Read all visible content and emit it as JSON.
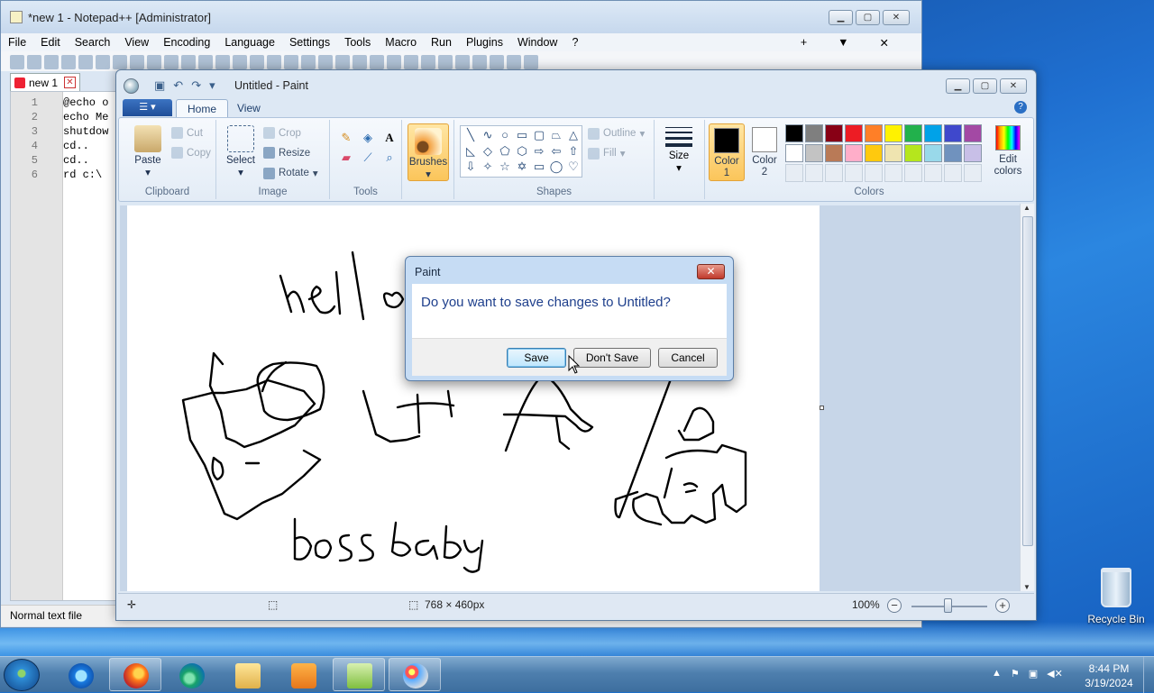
{
  "desktop": {
    "recycle_bin_label": "Recycle Bin"
  },
  "notepad": {
    "title": "*new 1 - Notepad++ [Administrator]",
    "menu": [
      "File",
      "Edit",
      "Search",
      "View",
      "Encoding",
      "Language",
      "Settings",
      "Tools",
      "Macro",
      "Run",
      "Plugins",
      "Window",
      "?"
    ],
    "menu_right": [
      "+",
      "▼",
      "✕"
    ],
    "tab_label": "new 1",
    "lines": [
      {
        "n": "1",
        "text": "@echo o"
      },
      {
        "n": "2",
        "text": "echo Me"
      },
      {
        "n": "3",
        "text": "shutdow"
      },
      {
        "n": "4",
        "text": "cd.."
      },
      {
        "n": "5",
        "text": "cd.."
      },
      {
        "n": "6",
        "text": "rd c:\\ "
      }
    ],
    "status": "Normal text file"
  },
  "paint": {
    "title": "Untitled - Paint",
    "tabs": {
      "home": "Home",
      "view": "View"
    },
    "clipboard": {
      "paste": "Paste",
      "cut": "Cut",
      "copy": "Copy",
      "label": "Clipboard"
    },
    "image": {
      "select": "Select",
      "crop": "Crop",
      "resize": "Resize",
      "rotate": "Rotate",
      "label": "Image"
    },
    "tools": {
      "label": "Tools"
    },
    "brushes": "Brushes",
    "shapes": {
      "outline": "Outline",
      "fill": "Fill",
      "label": "Shapes"
    },
    "size": "Size",
    "colors": {
      "color1_line1": "Color",
      "color1_line2": "1",
      "color2_line1": "Color",
      "color2_line2": "2",
      "edit_line1": "Edit",
      "edit_line2": "colors",
      "label": "Colors",
      "color1_value": "#000000",
      "color2_value": "#ffffff",
      "palette": [
        "#000000",
        "#7f7f7f",
        "#880015",
        "#ed1c24",
        "#ff7f27",
        "#fff200",
        "#22b14c",
        "#00a2e8",
        "#3f48cc",
        "#a349a4",
        "#ffffff",
        "#c3c3c3",
        "#b97a57",
        "#ffaec9",
        "#ffc90e",
        "#efe4b0",
        "#b5e61d",
        "#99d9ea",
        "#7092be",
        "#c8bfe7"
      ]
    },
    "status": {
      "dimensions": "768 × 460px",
      "zoom": "100%"
    },
    "canvas_text": {
      "hello": "hell o",
      "bossbaby": "boss baby"
    }
  },
  "dialog": {
    "title": "Paint",
    "message": "Do you want to save changes to Untitled?",
    "save": "Save",
    "dont_save": "Don't Save",
    "cancel": "Cancel"
  },
  "taskbar": {
    "time": "8:44 PM",
    "date": "3/19/2024"
  }
}
